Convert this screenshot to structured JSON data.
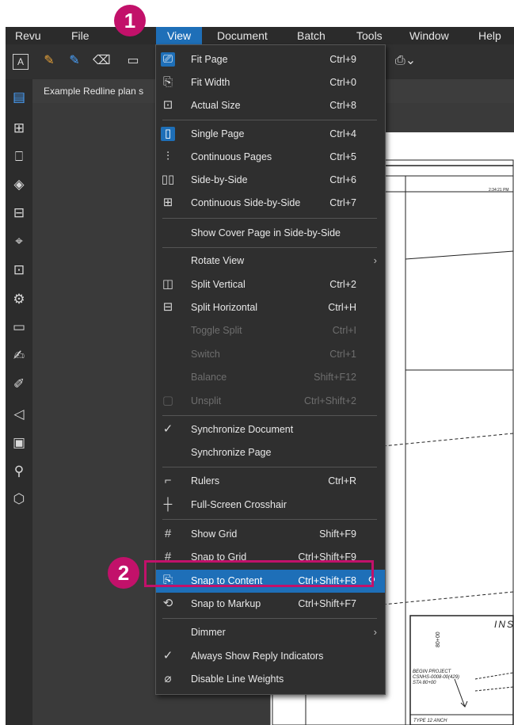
{
  "menubar": [
    "Revu",
    "File",
    "View",
    "Document",
    "Batch",
    "Tools",
    "Window",
    "Help"
  ],
  "tab_title": "Example Redline plan s",
  "view_menu": {
    "fit_page": {
      "label": "Fit Page",
      "shortcut": "Ctrl+9"
    },
    "fit_width": {
      "label": "Fit Width",
      "shortcut": "Ctrl+0"
    },
    "actual_size": {
      "label": "Actual Size",
      "shortcut": "Ctrl+8"
    },
    "single_page": {
      "label": "Single Page",
      "shortcut": "Ctrl+4"
    },
    "continuous_pages": {
      "label": "Continuous Pages",
      "shortcut": "Ctrl+5"
    },
    "side_by_side": {
      "label": "Side-by-Side",
      "shortcut": "Ctrl+6"
    },
    "continuous_side_by_side": {
      "label": "Continuous Side-by-Side",
      "shortcut": "Ctrl+7"
    },
    "show_cover_page": {
      "label": "Show Cover Page in Side-by-Side"
    },
    "rotate_view": {
      "label": "Rotate View"
    },
    "split_vertical": {
      "label": "Split Vertical",
      "shortcut": "Ctrl+2"
    },
    "split_horizontal": {
      "label": "Split Horizontal",
      "shortcut": "Ctrl+H"
    },
    "toggle_split": {
      "label": "Toggle Split",
      "shortcut": "Ctrl+I"
    },
    "switch": {
      "label": "Switch",
      "shortcut": "Ctrl+1"
    },
    "balance": {
      "label": "Balance",
      "shortcut": "Shift+F12"
    },
    "unsplit": {
      "label": "Unsplit",
      "shortcut": "Ctrl+Shift+2"
    },
    "synchronize_document": {
      "label": "Synchronize Document"
    },
    "synchronize_page": {
      "label": "Synchronize Page"
    },
    "rulers": {
      "label": "Rulers",
      "shortcut": "Ctrl+R"
    },
    "crosshair": {
      "label": "Full-Screen Crosshair"
    },
    "show_grid": {
      "label": "Show Grid",
      "shortcut": "Shift+F9"
    },
    "snap_to_grid": {
      "label": "Snap to Grid",
      "shortcut": "Ctrl+Shift+F9"
    },
    "snap_to_content": {
      "label": "Snap to Content",
      "shortcut": "Ctrl+Shift+F8"
    },
    "snap_to_markup": {
      "label": "Snap to Markup",
      "shortcut": "Ctrl+Shift+F7"
    },
    "dimmer": {
      "label": "Dimmer"
    },
    "reply_indicators": {
      "label": "Always Show Reply Indicators"
    },
    "disable_line_weights": {
      "label": "Disable Line Weights"
    }
  },
  "badges": {
    "one": "1",
    "two": "2"
  },
  "drawing": {
    "timestamp": "2:34:21 PM",
    "station": "80+00",
    "title": "INS",
    "begin_project_1": "BEGIN PROJECT",
    "begin_project_2": "CSNHS-0008-00(429)",
    "begin_project_3": "STA 80+00",
    "type_label": "TYPE 12 ANCH"
  },
  "colors": {
    "accent": "#1e6fb8",
    "badge": "#c2116a",
    "menu_bg": "#2f2f2f"
  }
}
